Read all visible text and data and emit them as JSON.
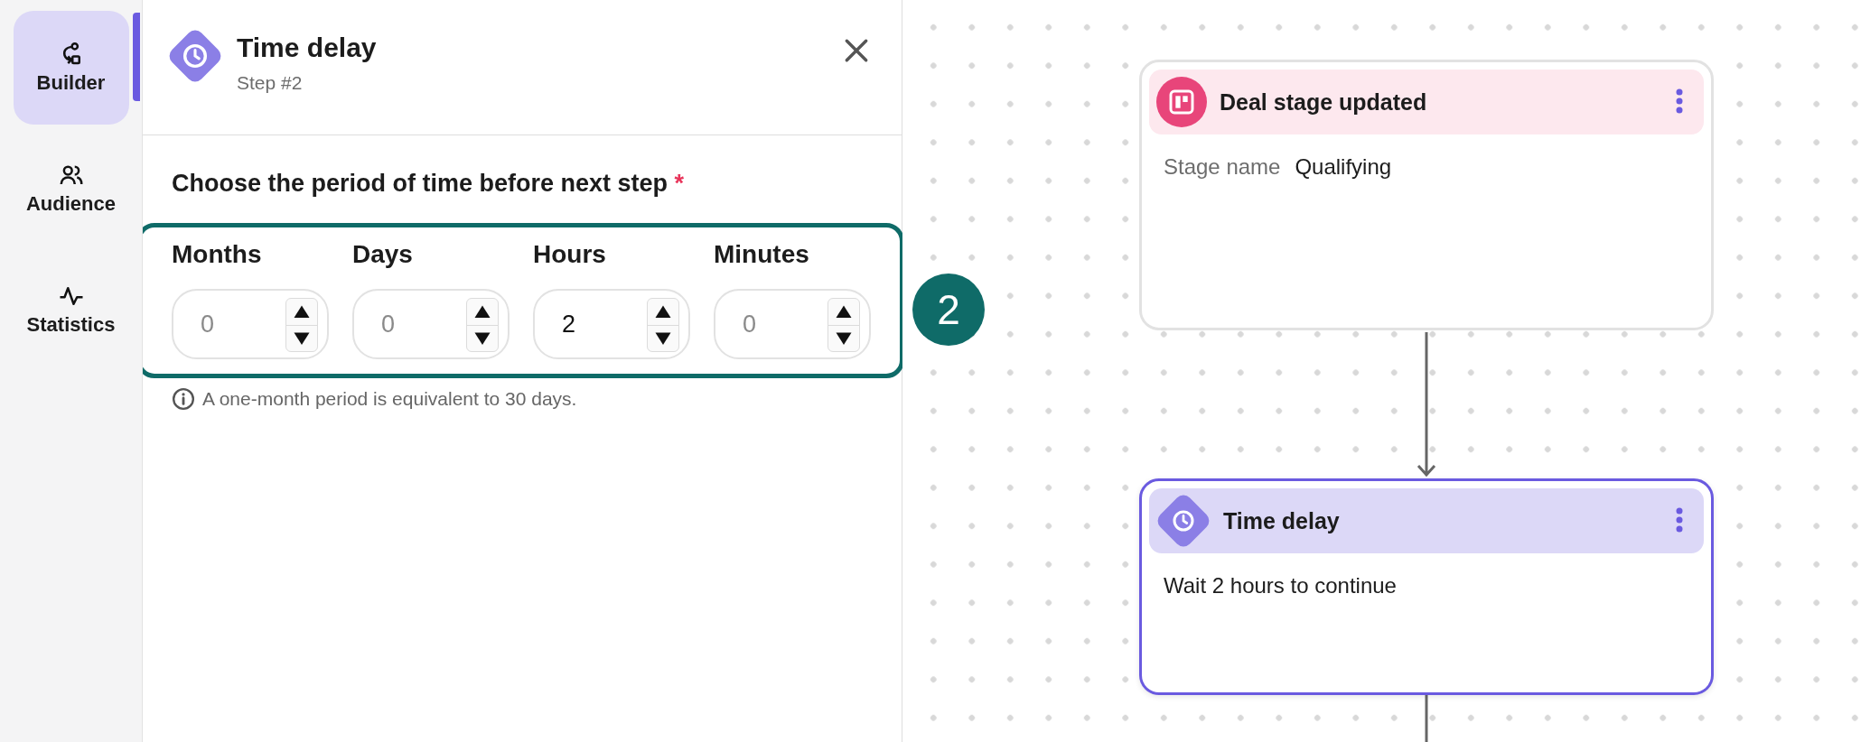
{
  "sidebar": {
    "items": [
      {
        "label": "Builder",
        "selected": true
      },
      {
        "label": "Audience",
        "selected": false
      },
      {
        "label": "Statistics",
        "selected": false
      }
    ]
  },
  "panel": {
    "title": "Time delay",
    "subtitle": "Step #2",
    "question": "Choose the period of time before next step",
    "required_mark": "*",
    "fields": [
      {
        "label": "Months",
        "placeholder": "0"
      },
      {
        "label": "Days",
        "placeholder": "0"
      },
      {
        "label": "Hours",
        "value": "2"
      },
      {
        "label": "Minutes",
        "placeholder": "0"
      }
    ],
    "callout_badge": "2",
    "info": "A one-month period is equivalent to 30 days."
  },
  "canvas": {
    "nodes": [
      {
        "kind": "trigger",
        "title": "Deal stage updated",
        "selected": false,
        "detail_label": "Stage name",
        "detail_value": "Qualifying"
      },
      {
        "kind": "delay",
        "title": "Time delay",
        "selected": true,
        "detail": "Wait 2 hours to continue"
      }
    ]
  }
}
